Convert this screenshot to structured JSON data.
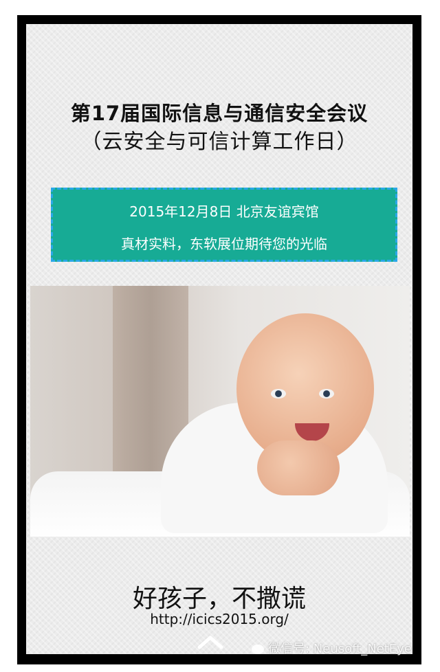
{
  "title": {
    "line1": "第17届国际信息与通信安全会议",
    "line2": "（云安全与可信计算工作日）"
  },
  "banner": {
    "line1": "2015年12月8日 北京友谊宾馆",
    "line2": "真材实料，东软展位期待您的光临",
    "background": "#17ab95",
    "border_color": "#2aa8e8"
  },
  "slogan": "好孩子，不撒谎",
  "url": "http://icics2015.org/",
  "watermark": "微信号: Neusoft_NetEye"
}
